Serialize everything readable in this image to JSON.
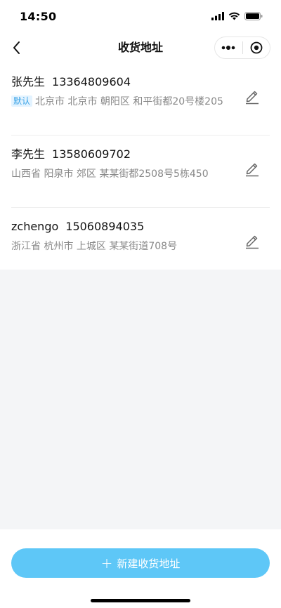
{
  "statusbar": {
    "time": "14:50",
    "icons": [
      "signal-icon",
      "wifi-icon",
      "battery-icon"
    ]
  },
  "navbar": {
    "title": "收货地址",
    "back_icon": "chevron-left-icon",
    "more_icon": "more-dots-icon",
    "close_icon": "target-icon"
  },
  "addresses": [
    {
      "name": "张先生",
      "phone": "13364809604",
      "default_label": "默认",
      "address": "北京市 北京市 朝阳区 和平街都20号楼205"
    },
    {
      "name": "李先生",
      "phone": "13580609702",
      "address": "山西省 阳泉市 郊区 某某街都2508号5栋450"
    },
    {
      "name": "zchengo",
      "phone": "15060894035",
      "address": "浙江省 杭州市 上城区 某某街道708号"
    }
  ],
  "add_button": {
    "label": "新建收货地址",
    "icon": "plus"
  },
  "colors": {
    "accent": "#5ec7f7",
    "badge_bg": "#e3f3ff",
    "badge_text": "#3aa3e6"
  }
}
